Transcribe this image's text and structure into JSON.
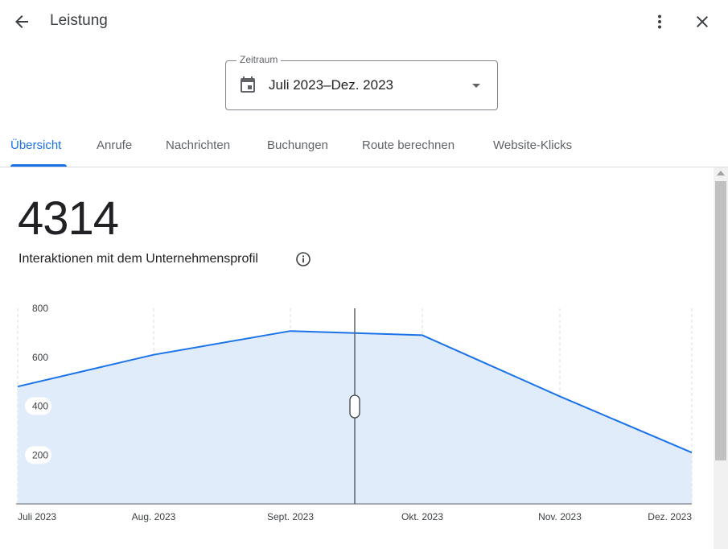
{
  "header": {
    "title": "Leistung",
    "icons": {
      "back": "arrow-back-icon",
      "more": "more-vert-icon",
      "close": "close-icon"
    }
  },
  "date_range": {
    "label": "Zeitraum",
    "value": "Juli 2023–Dez. 2023",
    "icons": {
      "calendar": "calendar-icon",
      "dropdown": "dropdown-caret-icon"
    }
  },
  "tabs": [
    {
      "label": "Übersicht",
      "active": true
    },
    {
      "label": "Anrufe",
      "active": false
    },
    {
      "label": "Nachrichten",
      "active": false
    },
    {
      "label": "Buchungen",
      "active": false
    },
    {
      "label": "Route berechnen",
      "active": false
    },
    {
      "label": "Website-Klicks",
      "active": false
    }
  ],
  "summary": {
    "total": "4314",
    "label": "Interaktionen mit dem Unternehmensprofil",
    "info_icon": "info-icon"
  },
  "colors": {
    "accent": "#1a73e8",
    "line": "#1a73e8",
    "area": "#e1ecfb"
  },
  "chart_data": {
    "type": "area",
    "categories": [
      "Juli 2023",
      "Aug. 2023",
      "Sept. 2023",
      "Okt. 2023",
      "Nov. 2023",
      "Dez. 2023"
    ],
    "values": [
      480,
      610,
      707,
      690,
      440,
      210
    ],
    "y_ticks": [
      "800",
      "600",
      "400",
      "200"
    ],
    "ylim": [
      0,
      800
    ],
    "grid": "vertical-dashed",
    "scrubber_at": "between Sept. 2023 and Okt. 2023"
  }
}
